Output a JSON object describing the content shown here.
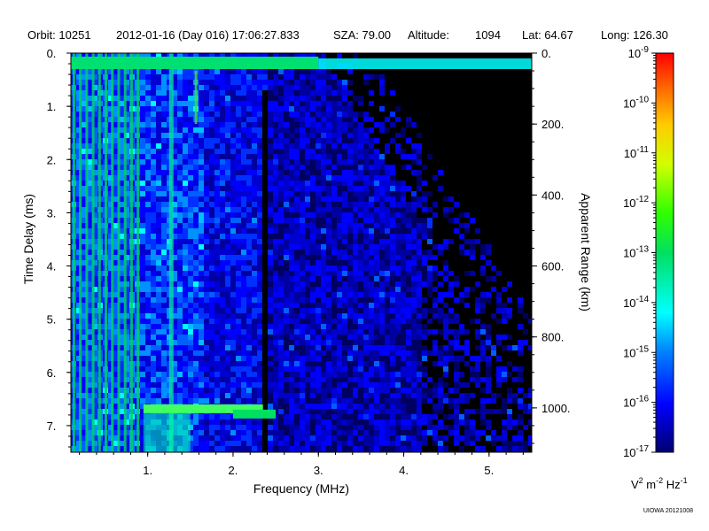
{
  "header": {
    "orbit": "Orbit: 10251",
    "datetime": "2012-01-16 (Day 016) 17:06:27.833",
    "sza": "SZA:  79.00",
    "altitude_label": "Altitude:",
    "altitude_value": "1094",
    "lat": "Lat:  64.67",
    "long": "Long: 126.30"
  },
  "credit": "UIOWA 20121008",
  "chart_data": {
    "type": "heatmap",
    "xlabel": "Frequency (MHz)",
    "ylabel_left": "Time Delay (ms)",
    "ylabel_right": "Apparent Range (km)",
    "xlim": [
      0.1,
      5.5
    ],
    "ylim_left": [
      0,
      7.5
    ],
    "x_ticks": [
      {
        "value": 1,
        "label": "1."
      },
      {
        "value": 2,
        "label": "2."
      },
      {
        "value": 3,
        "label": "3."
      },
      {
        "value": 4,
        "label": "4."
      },
      {
        "value": 5,
        "label": "5."
      }
    ],
    "y_ticks_left": [
      {
        "value": 0,
        "label": "0."
      },
      {
        "value": 1,
        "label": "1."
      },
      {
        "value": 2,
        "label": "2."
      },
      {
        "value": 3,
        "label": "3."
      },
      {
        "value": 4,
        "label": "4."
      },
      {
        "value": 5,
        "label": "5."
      },
      {
        "value": 6,
        "label": "6."
      },
      {
        "value": 7,
        "label": "7."
      }
    ],
    "y_ticks_right": [
      {
        "value": 0,
        "label": "0."
      },
      {
        "value": 200,
        "label": "200."
      },
      {
        "value": 400,
        "label": "400."
      },
      {
        "value": 600,
        "label": "600."
      },
      {
        "value": 800,
        "label": "800."
      },
      {
        "value": 1000,
        "label": "1000."
      }
    ],
    "km_per_ms": 150,
    "colorbar": {
      "exponents": [
        -9,
        -10,
        -11,
        -12,
        -13,
        -14,
        -15,
        -16,
        -17
      ],
      "base": "10",
      "unit_label": {
        "v": "V",
        "v_exp": "2",
        "m": " m",
        "m_exp": "-2",
        "hz": " Hz",
        "hz_exp": "-1"
      }
    },
    "features": [
      {
        "name": "ground echo",
        "delay_ms": 0.3,
        "freq_range": [
          0.1,
          5.5
        ]
      },
      {
        "name": "echo trace",
        "delay_ms": [
          6.6,
          7.0
        ],
        "freq_range": [
          0.9,
          2.5
        ]
      },
      {
        "name": "gap",
        "freq": 2.35
      }
    ]
  }
}
